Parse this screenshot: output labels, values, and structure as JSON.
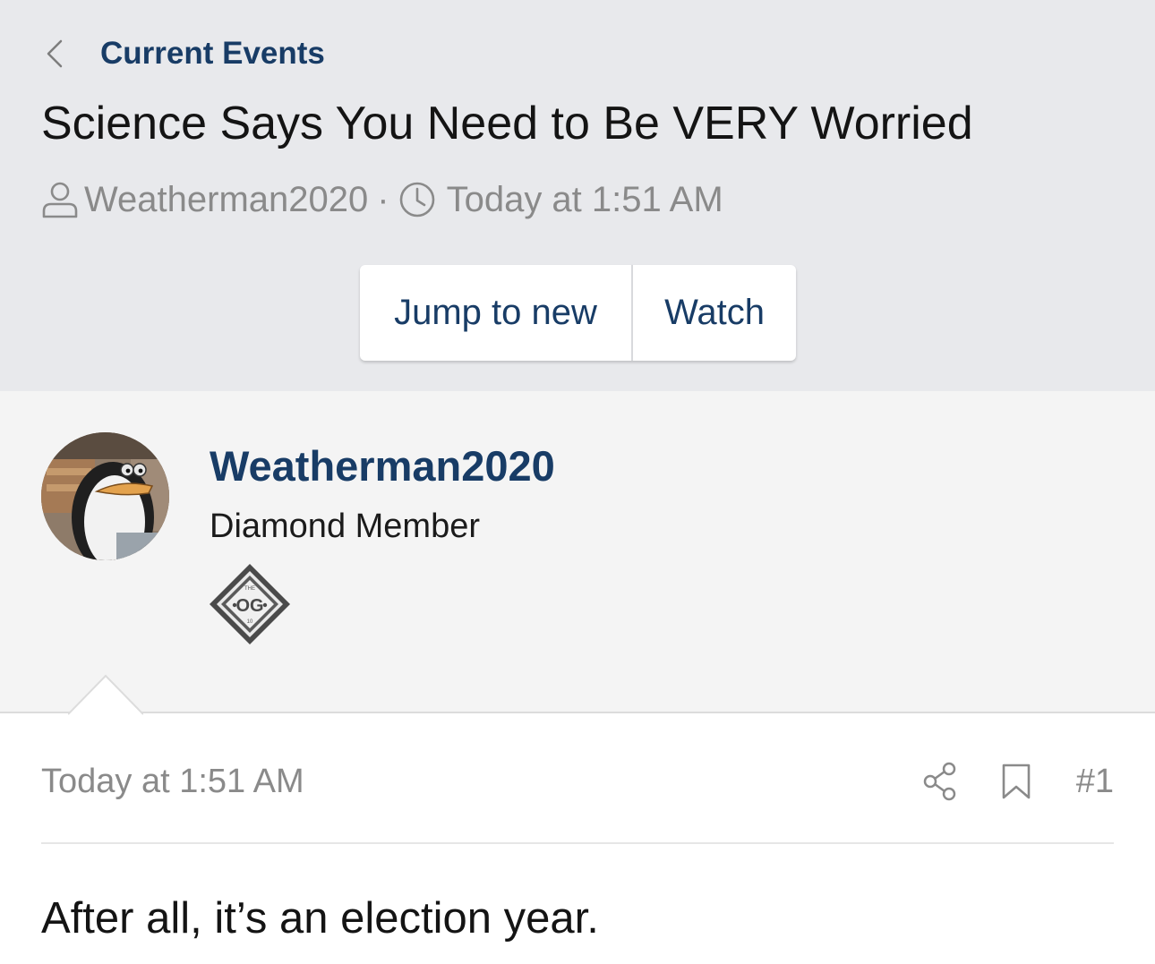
{
  "breadcrumb": {
    "label": "Current Events"
  },
  "thread": {
    "title": "Science Says You Need to Be VERY Worried",
    "author": "Weatherman2020",
    "separator": "·",
    "time": "Today at 1:51 AM"
  },
  "actions": {
    "jump_label": "Jump to new",
    "watch_label": "Watch"
  },
  "post": {
    "username": "Weatherman2020",
    "user_title": "Diamond Member",
    "badge": {
      "top_text": "THE",
      "main_text": "OG",
      "bottom_text": "10"
    },
    "time": "Today at 1:51 AM",
    "number": "#1",
    "body": "After all, it’s an election year."
  },
  "colors": {
    "link": "#183c66",
    "header_bg": "#e8e9ec",
    "panel_bg": "#f4f4f4",
    "muted": "#8a8a8a"
  },
  "icons": [
    "chevron-left-icon",
    "user-icon",
    "clock-icon",
    "share-icon",
    "bookmark-icon"
  ]
}
